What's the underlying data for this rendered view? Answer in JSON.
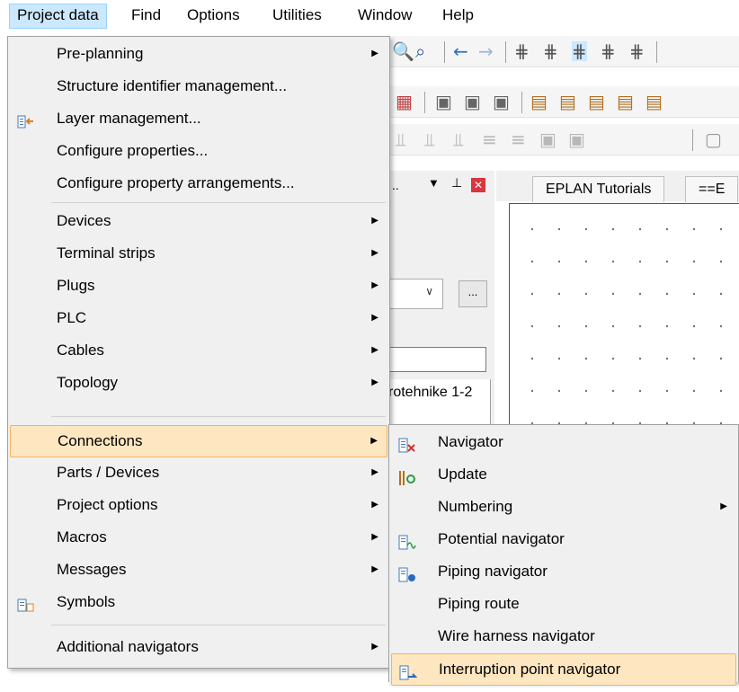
{
  "menubar": {
    "items": [
      "Project data",
      "Find",
      "Options",
      "Utilities",
      "Window",
      "Help"
    ]
  },
  "background": {
    "panel_more_button": "...",
    "tree_text": "rotehnike 1-2",
    "doc_tabs": [
      "EPLAN Tutorials",
      "==E"
    ]
  },
  "project_data_menu": {
    "items": [
      {
        "label": "Pre-planning",
        "submenu": true
      },
      {
        "label": "Structure identifier management...",
        "submenu": false
      },
      {
        "label": "Layer management...",
        "submenu": false,
        "icon": "layer-management-icon"
      },
      {
        "label": "Configure properties...",
        "submenu": false
      },
      {
        "label": "Configure property arrangements...",
        "submenu": false
      },
      {
        "label": "Devices",
        "submenu": true
      },
      {
        "label": "Terminal strips",
        "submenu": true
      },
      {
        "label": "Plugs",
        "submenu": true
      },
      {
        "label": "PLC",
        "submenu": true
      },
      {
        "label": "Cables",
        "submenu": true
      },
      {
        "label": "Topology",
        "submenu": true
      },
      {
        "label": "Connections",
        "submenu": true,
        "highlighted": true
      },
      {
        "label": "Parts / Devices",
        "submenu": true
      },
      {
        "label": "Project options",
        "submenu": true
      },
      {
        "label": "Macros",
        "submenu": true
      },
      {
        "label": "Messages",
        "submenu": true
      },
      {
        "label": "Symbols",
        "submenu": false,
        "icon": "symbols-icon"
      },
      {
        "label": "Additional navigators",
        "submenu": true
      }
    ]
  },
  "connections_submenu": {
    "items": [
      {
        "label": "Navigator",
        "icon": "navigator-icon"
      },
      {
        "label": "Update",
        "icon": "update-icon"
      },
      {
        "label": "Numbering",
        "submenu": true
      },
      {
        "label": "Potential navigator",
        "icon": "potential-navigator-icon"
      },
      {
        "label": "Piping navigator",
        "icon": "piping-navigator-icon"
      },
      {
        "label": "Piping route"
      },
      {
        "label": "Wire harness navigator"
      },
      {
        "label": "Interruption point navigator",
        "icon": "interruption-point-icon",
        "highlighted": true
      }
    ]
  },
  "colors": {
    "menu_bg": "#f0f0f0",
    "highlight_bg": "#fde6c0",
    "highlight_border": "#f2b561",
    "menubar_active": "#cce8ff"
  }
}
